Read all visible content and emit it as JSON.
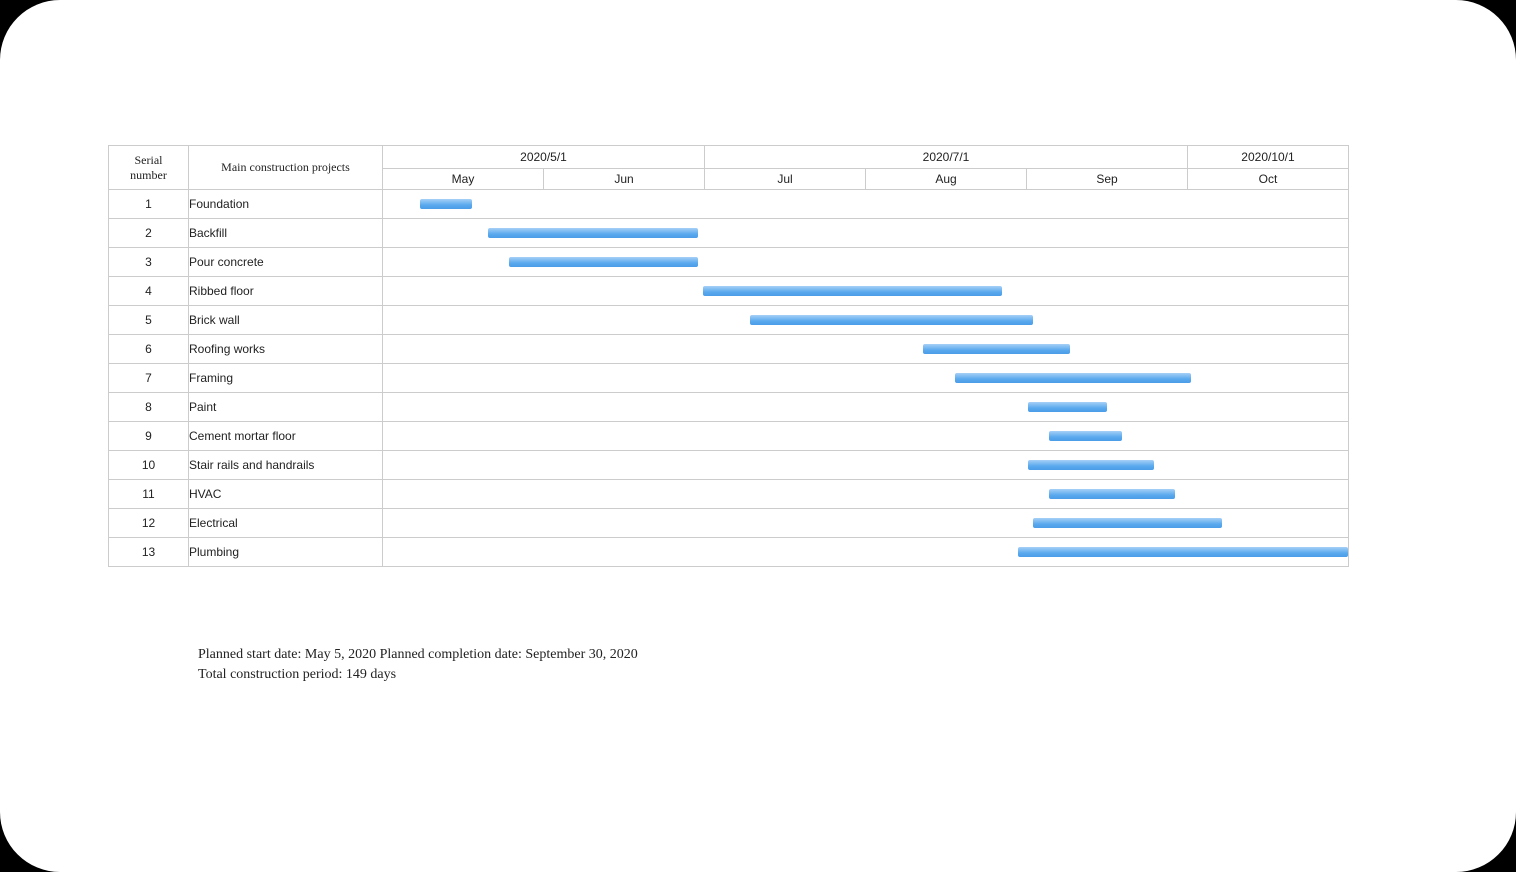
{
  "headers": {
    "serial": "Serial number",
    "main": "Main construction projects",
    "date_groups": [
      {
        "label": "2020/5/1",
        "span": 2
      },
      {
        "label": "2020/7/1",
        "span": 3
      },
      {
        "label": "2020/10/1",
        "span": 1
      }
    ],
    "months": [
      "May",
      "Jun",
      "Jul",
      "Aug",
      "Sep",
      "Oct"
    ]
  },
  "chart_data": {
    "type": "bar",
    "title": "",
    "xlabel": "",
    "ylabel": "",
    "x_axis": {
      "type": "date",
      "start": "2020-05-01",
      "end": "2020-11-01",
      "months": [
        "May",
        "Jun",
        "Jul",
        "Aug",
        "Sep",
        "Oct"
      ]
    },
    "series": [
      {
        "id": 1,
        "name": "Foundation",
        "start": "2020-05-08",
        "end": "2020-05-18"
      },
      {
        "id": 2,
        "name": "Backfill",
        "start": "2020-05-21",
        "end": "2020-06-30"
      },
      {
        "id": 3,
        "name": "Pour concrete",
        "start": "2020-05-25",
        "end": "2020-06-30"
      },
      {
        "id": 4,
        "name": "Ribbed floor",
        "start": "2020-07-01",
        "end": "2020-08-27"
      },
      {
        "id": 5,
        "name": "Brick wall",
        "start": "2020-07-10",
        "end": "2020-09-02"
      },
      {
        "id": 6,
        "name": "Roofing works",
        "start": "2020-08-12",
        "end": "2020-09-09"
      },
      {
        "id": 7,
        "name": "Framing",
        "start": "2020-08-18",
        "end": "2020-10-02"
      },
      {
        "id": 8,
        "name": "Paint",
        "start": "2020-09-01",
        "end": "2020-09-16"
      },
      {
        "id": 9,
        "name": "Cement mortar floor",
        "start": "2020-09-05",
        "end": "2020-09-19"
      },
      {
        "id": 10,
        "name": "Stair rails and handrails",
        "start": "2020-09-01",
        "end": "2020-09-25"
      },
      {
        "id": 11,
        "name": "HVAC",
        "start": "2020-09-05",
        "end": "2020-09-29"
      },
      {
        "id": 12,
        "name": "Electrical",
        "start": "2020-09-02",
        "end": "2020-10-08"
      },
      {
        "id": 13,
        "name": "Plumbing",
        "start": "2020-08-30",
        "end": "2020-11-01"
      }
    ]
  },
  "footer": "Planned start date: May 5, 2020 Planned completion date: September 30, 2020 Total construction period: 149 days"
}
